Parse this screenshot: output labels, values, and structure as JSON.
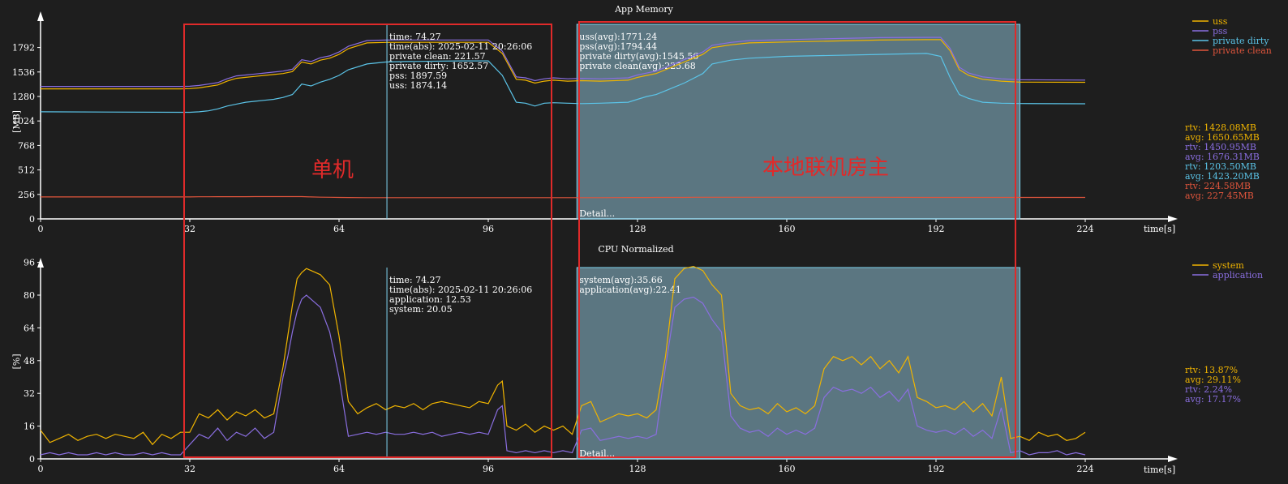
{
  "colors": {
    "background": "#1e1e1e",
    "axis": "#ffffff",
    "uss": "#f0b400",
    "pss": "#8a6ee0",
    "private_dirty": "#5bc4e8",
    "private_clean": "#e0553c",
    "system": "#f0b400",
    "application": "#8a6ee0",
    "cursor": "#7fd4f0",
    "selection_fill": "#9fd8ee",
    "annotation_box": "#e02a2a",
    "annotation_text": "#e02a2a"
  },
  "annotations": {
    "left_label": "单机",
    "right_label": "本地联机房主"
  },
  "chart_data": [
    {
      "type": "line",
      "title": "App Memory",
      "xlabel": "time[s]",
      "ylabel": "[MB]",
      "xlim": [
        0,
        240
      ],
      "ylim": [
        0,
        2048
      ],
      "xticks": [
        0,
        32,
        64,
        96,
        128,
        160,
        192,
        224
      ],
      "yticks": [
        0,
        256,
        512,
        768,
        1024,
        1280,
        1536,
        1792
      ],
      "legend": [
        "uss",
        "pss",
        "private dirty",
        "private clean"
      ],
      "legend_position": "top-right",
      "x": [
        0,
        30,
        32,
        34,
        36,
        38,
        40,
        42,
        44,
        46,
        48,
        50,
        52,
        54,
        56,
        58,
        60,
        62,
        64,
        66,
        70,
        74,
        78,
        90,
        96,
        99,
        102,
        104,
        106,
        108,
        110,
        113,
        116,
        120,
        126,
        128,
        130,
        132,
        134,
        136,
        138,
        140,
        142,
        144,
        148,
        152,
        160,
        170,
        180,
        190,
        193,
        195,
        197,
        199,
        202,
        206,
        210,
        224
      ],
      "series": [
        {
          "name": "uss",
          "values": [
            1360,
            1360,
            1362,
            1370,
            1385,
            1400,
            1440,
            1470,
            1480,
            1490,
            1500,
            1510,
            1520,
            1540,
            1640,
            1620,
            1660,
            1680,
            1720,
            1780,
            1840,
            1845,
            1846,
            1846,
            1846,
            1730,
            1460,
            1450,
            1420,
            1440,
            1450,
            1440,
            1445,
            1440,
            1450,
            1480,
            1500,
            1520,
            1560,
            1600,
            1640,
            1680,
            1720,
            1790,
            1820,
            1840,
            1850,
            1860,
            1870,
            1874,
            1874,
            1760,
            1560,
            1500,
            1460,
            1440,
            1430,
            1428
          ]
        },
        {
          "name": "pss",
          "values": [
            1385,
            1385,
            1387,
            1395,
            1410,
            1425,
            1465,
            1495,
            1505,
            1515,
            1525,
            1535,
            1545,
            1565,
            1665,
            1645,
            1685,
            1705,
            1745,
            1805,
            1865,
            1870,
            1871,
            1871,
            1871,
            1755,
            1485,
            1475,
            1445,
            1465,
            1475,
            1465,
            1470,
            1465,
            1475,
            1505,
            1525,
            1545,
            1585,
            1625,
            1665,
            1705,
            1745,
            1815,
            1845,
            1865,
            1875,
            1885,
            1895,
            1898,
            1898,
            1785,
            1585,
            1525,
            1485,
            1465,
            1455,
            1451
          ]
        },
        {
          "name": "private dirty",
          "values": [
            1120,
            1115,
            1115,
            1120,
            1130,
            1150,
            1180,
            1200,
            1220,
            1230,
            1240,
            1250,
            1270,
            1300,
            1410,
            1390,
            1430,
            1460,
            1500,
            1560,
            1620,
            1640,
            1645,
            1652,
            1652,
            1500,
            1220,
            1210,
            1180,
            1210,
            1215,
            1210,
            1205,
            1210,
            1220,
            1250,
            1280,
            1300,
            1340,
            1380,
            1420,
            1470,
            1520,
            1620,
            1660,
            1680,
            1700,
            1710,
            1720,
            1730,
            1700,
            1480,
            1300,
            1260,
            1220,
            1210,
            1206,
            1204
          ]
        },
        {
          "name": "private clean",
          "values": [
            230,
            230,
            230,
            231,
            231,
            232,
            232,
            232,
            232,
            233,
            233,
            233,
            233,
            233,
            233,
            230,
            227,
            226,
            225,
            224,
            222,
            222,
            222,
            222,
            222,
            222,
            222,
            222,
            222,
            222,
            222,
            222,
            222,
            222,
            224,
            224,
            224,
            225,
            225,
            225,
            225,
            226,
            226,
            226,
            226,
            226,
            226,
            226,
            226,
            225,
            225,
            225,
            225,
            225,
            225,
            225,
            225,
            225
          ]
        }
      ],
      "stats": [
        {
          "name": "uss",
          "rtv": "rtv: 1428.08MB",
          "avg": "avg: 1650.65MB"
        },
        {
          "name": "pss",
          "rtv": "rtv: 1450.95MB",
          "avg": "avg: 1676.31MB"
        },
        {
          "name": "private dirty",
          "rtv": "rtv: 1203.50MB",
          "avg": "avg: 1423.20MB"
        },
        {
          "name": "private clean",
          "rtv": "rtv: 224.58MB",
          "avg": "avg: 227.45MB"
        }
      ],
      "cursor": {
        "x": 74.27,
        "lines": [
          "time: 74.27",
          "time(abs): 2025-02-11 20:26:06",
          "private clean: 221.57",
          "private dirty: 1652.57",
          "pss: 1897.59",
          "uss: 1874.14"
        ]
      },
      "selection": {
        "range": [
          115,
          210
        ],
        "lines": [
          "uss(avg):1771.24",
          "pss(avg):1794.44",
          "private dirty(avg):1545.56",
          "private clean(avg):225.68"
        ],
        "footer": "Detail..."
      }
    },
    {
      "type": "line",
      "title": "CPU Normalized",
      "xlabel": "time[s]",
      "ylabel": "[%]",
      "xlim": [
        0,
        240
      ],
      "ylim": [
        0,
        104
      ],
      "xticks": [
        0,
        32,
        64,
        96,
        128,
        160,
        192,
        224
      ],
      "yticks": [
        0,
        16,
        32,
        48,
        64,
        80,
        96
      ],
      "legend": [
        "system",
        "application"
      ],
      "legend_position": "top-right",
      "x": [
        0,
        2,
        4,
        6,
        8,
        10,
        12,
        14,
        16,
        18,
        20,
        22,
        24,
        26,
        28,
        30,
        32,
        34,
        36,
        38,
        40,
        42,
        44,
        46,
        48,
        50,
        52,
        53,
        54,
        55,
        56,
        57,
        58,
        60,
        62,
        64,
        66,
        68,
        70,
        72,
        74,
        76,
        78,
        80,
        82,
        84,
        86,
        88,
        90,
        92,
        94,
        96,
        98,
        99,
        100,
        102,
        104,
        106,
        108,
        110,
        112,
        114,
        116,
        118,
        120,
        122,
        124,
        126,
        128,
        130,
        132,
        134,
        136,
        138,
        140,
        142,
        144,
        146,
        148,
        150,
        152,
        154,
        156,
        158,
        160,
        162,
        164,
        166,
        168,
        170,
        172,
        174,
        176,
        178,
        180,
        182,
        184,
        186,
        188,
        190,
        192,
        194,
        196,
        198,
        200,
        202,
        204,
        206,
        208,
        210,
        212,
        214,
        216,
        218,
        220,
        222,
        224
      ],
      "series": [
        {
          "name": "system",
          "values": [
            14,
            8,
            10,
            12,
            9,
            11,
            12,
            10,
            12,
            11,
            10,
            13,
            7,
            12,
            10,
            13,
            13,
            22,
            20,
            24,
            19,
            23,
            21,
            24,
            20,
            22,
            45,
            60,
            75,
            88,
            91,
            93,
            92,
            90,
            85,
            60,
            28,
            22,
            25,
            27,
            24,
            26,
            25,
            27,
            24,
            27,
            28,
            27,
            26,
            25,
            28,
            27,
            36,
            38,
            16,
            14,
            17,
            13,
            16,
            14,
            16,
            12,
            26,
            28,
            18,
            20,
            22,
            21,
            22,
            20,
            24,
            50,
            88,
            93,
            94,
            92,
            85,
            80,
            32,
            26,
            24,
            25,
            22,
            27,
            23,
            25,
            22,
            26,
            44,
            50,
            48,
            50,
            46,
            50,
            44,
            48,
            42,
            50,
            30,
            28,
            25,
            26,
            24,
            28,
            23,
            27,
            21,
            40,
            10,
            11,
            9,
            13,
            11,
            12,
            9,
            10,
            13
          ]
        },
        {
          "name": "application",
          "values": [
            2,
            3,
            2,
            3,
            2,
            2,
            3,
            2,
            3,
            2,
            2,
            3,
            2,
            3,
            2,
            2,
            7,
            12,
            10,
            15,
            9,
            13,
            11,
            15,
            10,
            13,
            40,
            50,
            62,
            72,
            78,
            80,
            78,
            74,
            62,
            40,
            11,
            12,
            13,
            12,
            13,
            12,
            12,
            13,
            12,
            13,
            11,
            12,
            13,
            12,
            13,
            12,
            24,
            26,
            4,
            3,
            4,
            3,
            4,
            3,
            4,
            3,
            14,
            15,
            9,
            10,
            11,
            10,
            11,
            10,
            12,
            45,
            74,
            78,
            79,
            76,
            68,
            62,
            21,
            15,
            13,
            14,
            11,
            15,
            12,
            14,
            12,
            15,
            30,
            35,
            33,
            34,
            32,
            35,
            30,
            33,
            28,
            34,
            16,
            14,
            13,
            14,
            12,
            15,
            11,
            14,
            10,
            25,
            3,
            4,
            2,
            3,
            3,
            4,
            2,
            3,
            2
          ]
        }
      ],
      "stats": [
        {
          "name": "system",
          "rtv": "rtv: 13.87%",
          "avg": "avg: 29.11%"
        },
        {
          "name": "application",
          "rtv": "rtv: 2.24%",
          "avg": "avg: 17.17%"
        }
      ],
      "cursor": {
        "x": 74.27,
        "lines": [
          "time: 74.27",
          "time(abs): 2025-02-11 20:26:06",
          "application: 12.53",
          "system: 20.05"
        ]
      },
      "selection": {
        "range": [
          115,
          210
        ],
        "lines": [
          "system(avg):35.66",
          "application(avg):22.41"
        ],
        "footer": "Detail..."
      }
    }
  ]
}
